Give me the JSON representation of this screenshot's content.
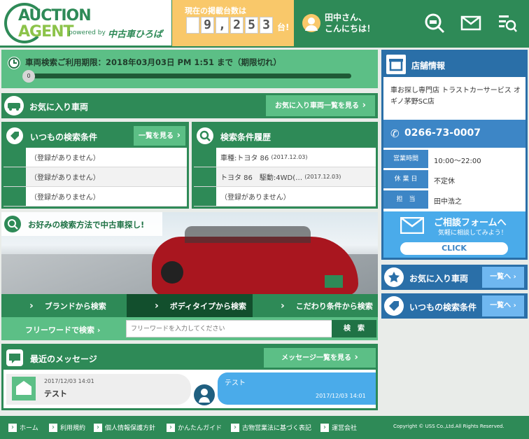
{
  "header": {
    "logo_line1": "AUCTION",
    "logo_line2": "AGENT",
    "logo_powered": "powered by",
    "logo_brand": "中古車ひろば",
    "count_label": "現在の掲載台数は",
    "count_digits": [
      "9",
      ",",
      "2",
      "5",
      "3"
    ],
    "count_unit": "台!",
    "greeting_line1": "田中さん、",
    "greeting_line2": "こんにちは！"
  },
  "expiry": {
    "text": "車両検索ご利用期限：2018年03月03日 PM 1:51 まで（期限切れ）",
    "progress_value": "0",
    "progress_fraction": 0
  },
  "favorites": {
    "title": "お気に入り車両",
    "button": "お気に入り車両一覧を見る"
  },
  "saved_search": {
    "title": "いつもの検索条件",
    "button": "一覧を見る",
    "rows": [
      "（登録がありません）",
      "（登録がありません）",
      "（登録がありません）"
    ]
  },
  "history": {
    "title": "検索条件履歴",
    "rows": [
      {
        "text": "車種:トヨタ 86",
        "date": "(2017.12.03)"
      },
      {
        "text": "トヨタ 86　駆動:4WD(…",
        "date": "(2017.12.03)"
      },
      {
        "text": "（登録がありません）",
        "date": ""
      }
    ]
  },
  "search_methods": {
    "title": "お好みの検索方法で中古車探し!",
    "tabs": [
      "ブランドから検索",
      "ボディタイプから検索",
      "こだわり条件から検索"
    ],
    "freeword_label": "フリーワードで検索",
    "freeword_placeholder": "フリーワードを入力してください",
    "search_button": "検　索"
  },
  "messages": {
    "title": "最近のメッセージ",
    "button": "メッセージ一覧を見る",
    "left_time": "2017/12/03 14:01",
    "left_text": "テスト",
    "right_text": "テスト",
    "right_time": "2017/12/03 14:01"
  },
  "store": {
    "title": "店舗情報",
    "name": "車お探し専門店 トラストカーサービス オギノ茅野SC店",
    "phone": "0266-73-0007",
    "hours_label": "営業時間",
    "hours": "10:00～22:00",
    "holiday_label": "休 業 日",
    "holiday": "不定休",
    "staff_label": "担　当",
    "staff": "田中浩之",
    "consult_title": "ご相談フォームへ",
    "consult_sub": "気軽に相談してみよう！",
    "consult_button": "CLICK"
  },
  "side_links": [
    {
      "label": "お気に入り車両",
      "button": "一覧へ"
    },
    {
      "label": "いつもの検索条件",
      "button": "一覧へ"
    }
  ],
  "footer": {
    "links": [
      "ホーム",
      "利用規約",
      "個人情報保護方針",
      "かんたんガイド",
      "古物営業法に基づく表記",
      "運営会社"
    ],
    "copyright": "Copyright © USS Co.,Ltd.All Rights Reserved."
  },
  "colors": {
    "brand_green": "#2e8a57",
    "light_green": "#5cbf86",
    "accent_yellow": "#f9c86a",
    "side_blue": "#2a6fa8"
  }
}
